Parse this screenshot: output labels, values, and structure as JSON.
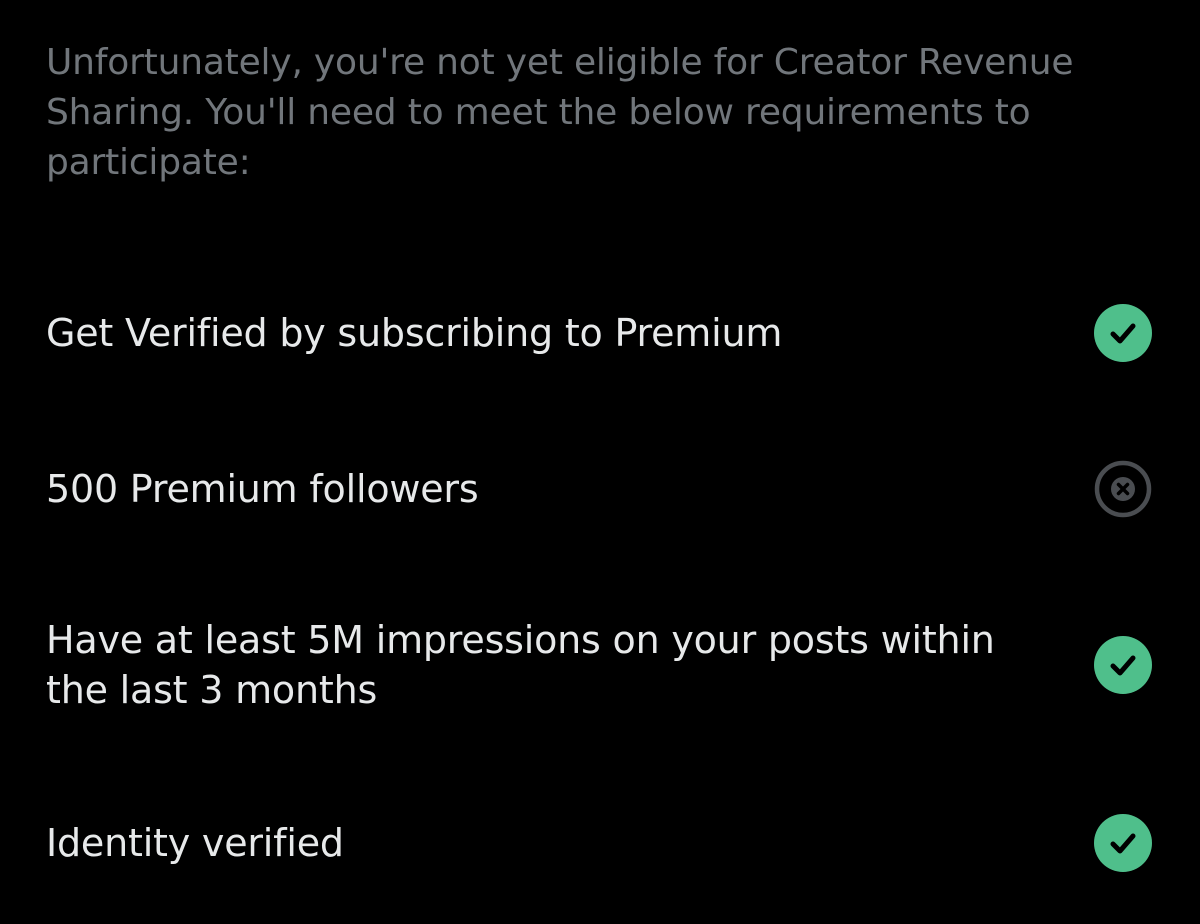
{
  "intro_text": "Unfortunately, you're not yet eligible for Creator Revenue Sharing. You'll need to meet the below requirements to participate:",
  "requirements": [
    {
      "label": "Get Verified by subscribing to Premium",
      "met": true,
      "icon": "check-circle-icon"
    },
    {
      "label": "500 Premium followers",
      "met": false,
      "icon": "x-circle-icon"
    },
    {
      "label": "Have at least 5M impressions on your posts within the last 3 months",
      "met": true,
      "icon": "check-circle-icon"
    },
    {
      "label": "Identity verified",
      "met": true,
      "icon": "check-circle-icon"
    }
  ],
  "colors": {
    "background": "#000000",
    "intro_text": "#71767b",
    "label_text": "#e7e9ea",
    "met_fill": "#4fbf8b",
    "unmet_ring": "#4a4d51"
  }
}
